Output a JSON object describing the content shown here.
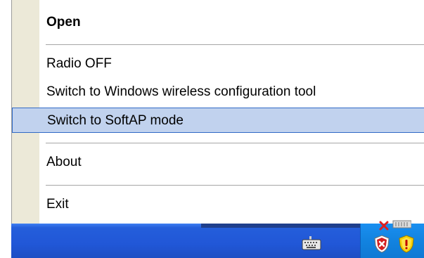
{
  "menu": {
    "items": [
      {
        "label": "Open",
        "bold": true
      },
      {
        "label": "Radio OFF"
      },
      {
        "label": "Switch to Windows wireless configuration tool"
      },
      {
        "label": "Switch to SoftAP mode",
        "highlighted": true
      },
      {
        "label": "About"
      },
      {
        "label": "Exit"
      }
    ]
  },
  "taskbar": {
    "icons": [
      "keyboard-icon",
      "network-error-icon",
      "shield-alert-icon",
      "security-warning-icon"
    ]
  },
  "colors": {
    "highlight": "#c1d2ee",
    "highlight_border": "#316ac5",
    "gutter": "#ece9d8",
    "taskbar": "#245edb",
    "tray": "#1283e0"
  }
}
